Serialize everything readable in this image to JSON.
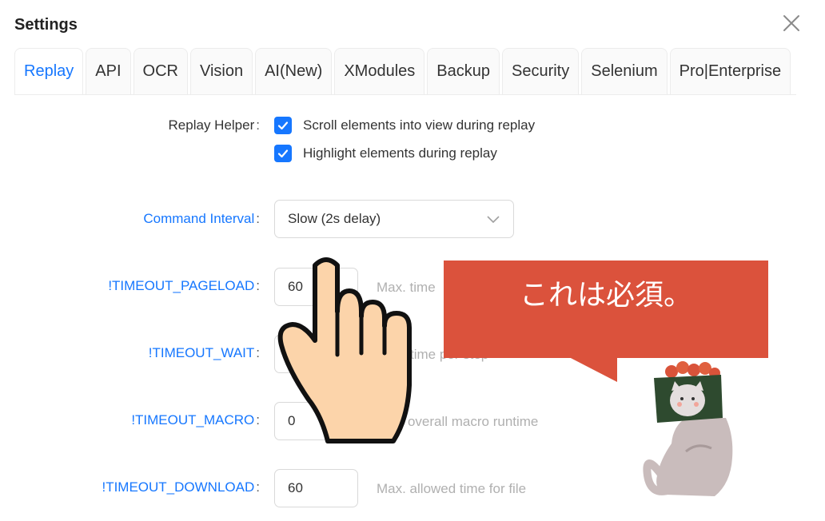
{
  "dialog": {
    "title": "Settings"
  },
  "close": {
    "icon": "close-icon"
  },
  "tabs": [
    {
      "label": "Replay",
      "active": true
    },
    {
      "label": "API"
    },
    {
      "label": "OCR"
    },
    {
      "label": "Vision"
    },
    {
      "label": "AI(New)"
    },
    {
      "label": "XModules"
    },
    {
      "label": "Backup"
    },
    {
      "label": "Security"
    },
    {
      "label": "Selenium"
    },
    {
      "label": "Pro|Enterprise"
    }
  ],
  "replay_helper": {
    "label": "Replay Helper",
    "options": [
      {
        "label": "Scroll elements into view during replay",
        "checked": true
      },
      {
        "label": "Highlight elements during replay",
        "checked": true
      }
    ]
  },
  "command_interval": {
    "label": "Command Interval",
    "value": "Slow (2s delay)"
  },
  "timeouts": [
    {
      "label": "!TIMEOUT_PAGELOAD",
      "value": "60",
      "hint": "Max. time"
    },
    {
      "label": "!TIMEOUT_WAIT",
      "value": "",
      "hint": "time per step"
    },
    {
      "label": "!TIMEOUT_MACRO",
      "value": "0",
      "hint": "x. overall macro runtime"
    },
    {
      "label": "!TIMEOUT_DOWNLOAD",
      "value": "60",
      "hint": "Max. allowed time for file"
    }
  ],
  "callout": {
    "text": "これは必須。"
  },
  "colors": {
    "accent": "#1677ff",
    "callout": "#db523c"
  }
}
